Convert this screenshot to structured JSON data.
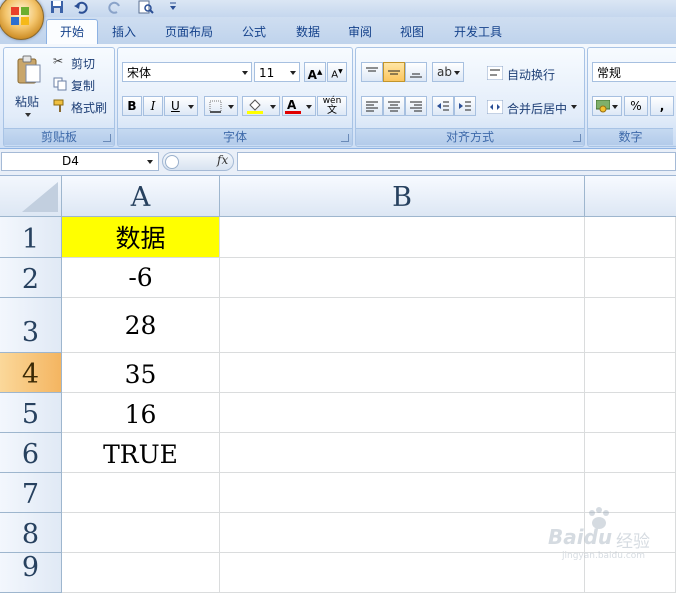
{
  "tabs": [
    "开始",
    "插入",
    "页面布局",
    "公式",
    "数据",
    "审阅",
    "视图",
    "开发工具"
  ],
  "clipboard": {
    "paste_label": "粘贴",
    "cut_label": "剪切",
    "copy_label": "复制",
    "format_painter_label": "格式刷",
    "group_label": "剪贴板"
  },
  "font": {
    "name_value": "宋体",
    "size_value": "11",
    "grow_label": "A",
    "shrink_label": "A",
    "bold_label": "B",
    "italic_label": "I",
    "underline_label": "U",
    "font_color_label": "A",
    "phonetic_label": "wén",
    "phonetic_char": "文",
    "group_label": "字体"
  },
  "alignment": {
    "wrap_label": "自动换行",
    "merge_label": "合并后居中",
    "group_label": "对齐方式"
  },
  "number": {
    "format_value": "常规",
    "percent_label": "%",
    "comma_label": ",",
    "group_label": "数字"
  },
  "formula_bar": {
    "name_box_value": "D4",
    "fx_label": "fx",
    "formula_value": ""
  },
  "columns": [
    "A",
    "B"
  ],
  "rows": [
    {
      "num": "1",
      "a": "数据"
    },
    {
      "num": "2",
      "a": "-6"
    },
    {
      "num": "3",
      "a": "28"
    },
    {
      "num": "4",
      "a": "35"
    },
    {
      "num": "5",
      "a": "16"
    },
    {
      "num": "6",
      "a": "TRUE"
    },
    {
      "num": "7",
      "a": ""
    },
    {
      "num": "8",
      "a": ""
    },
    {
      "num": "9",
      "a": ""
    }
  ],
  "colors": {
    "header_fill": "#ffff00",
    "selected_row_header": "#f4b561",
    "ribbon_text": "#15428b"
  },
  "watermark": {
    "brand": "Baidu",
    "brand_cn": "经验",
    "url": "jingyan.baidu.com"
  }
}
